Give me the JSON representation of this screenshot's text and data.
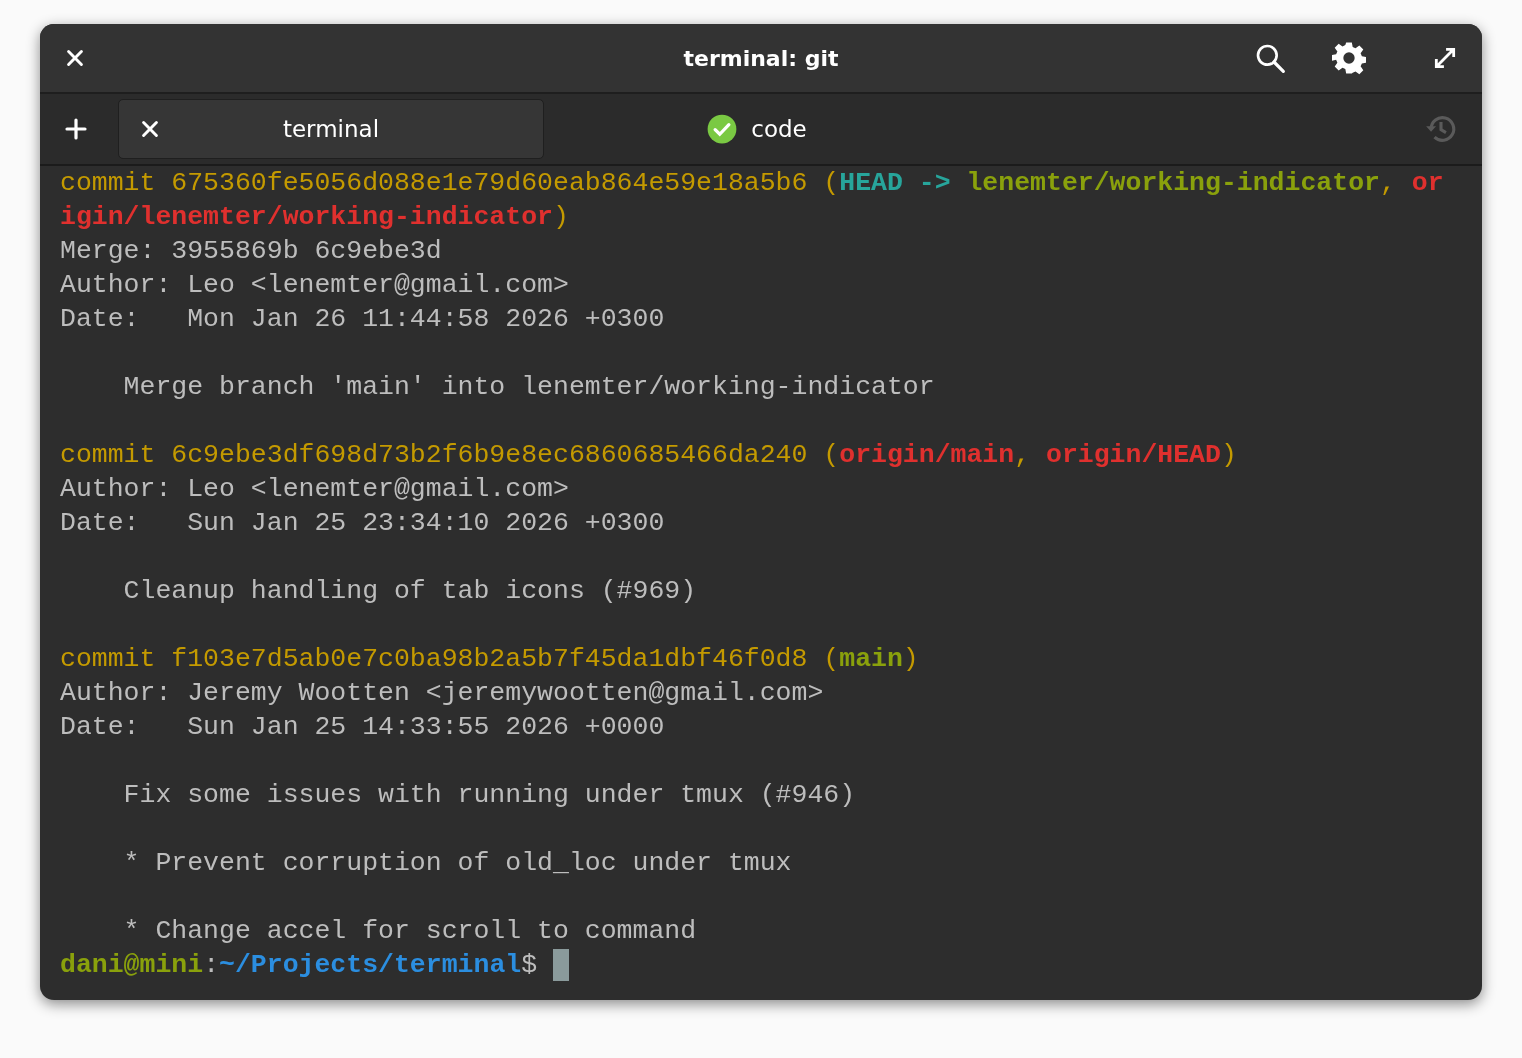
{
  "window": {
    "title": "terminal: git"
  },
  "tabs": [
    {
      "label": "terminal",
      "selected": true,
      "done": false
    },
    {
      "label": "code",
      "selected": false,
      "done": true
    }
  ],
  "paragraphs": [
    [
      {
        "segments": [
          {
            "text": "commit 675360fe5056d088e1e79d60eab864e59e18a5b6 (",
            "kind": "commit"
          },
          {
            "text": "HEAD -> ",
            "kind": "head"
          },
          {
            "text": "lenemter/working-indicator",
            "kind": "local"
          },
          {
            "text": ", ",
            "kind": "commit"
          },
          {
            "text": "or",
            "kind": "remote"
          }
        ]
      },
      {
        "segments": [
          {
            "text": "igin/lenemter/working-indicator",
            "kind": "remote"
          },
          {
            "text": ")",
            "kind": "commit"
          }
        ]
      },
      {
        "segments": [
          {
            "text": "Merge: 3955869b 6c9ebe3d",
            "kind": "plain"
          }
        ]
      },
      {
        "segments": [
          {
            "text": "Author: Leo <lenemter@gmail.com>",
            "kind": "plain"
          }
        ]
      },
      {
        "segments": [
          {
            "text": "Date:   Mon Jan 26 11:44:58 2026 +0300",
            "kind": "plain"
          }
        ]
      }
    ],
    [
      {
        "segments": [
          {
            "text": "    Merge branch 'main' into lenemter/working-indicator",
            "kind": "plain"
          }
        ]
      }
    ],
    [
      {
        "segments": [
          {
            "text": "commit 6c9ebe3df698d73b2f6b9e8ec6860685466da240 (",
            "kind": "commit"
          },
          {
            "text": "origin/main",
            "kind": "remote"
          },
          {
            "text": ", ",
            "kind": "commit"
          },
          {
            "text": "origin/HEAD",
            "kind": "remote"
          },
          {
            "text": ")",
            "kind": "commit"
          }
        ]
      },
      {
        "segments": [
          {
            "text": "Author: Leo <lenemter@gmail.com>",
            "kind": "plain"
          }
        ]
      },
      {
        "segments": [
          {
            "text": "Date:   Sun Jan 25 23:34:10 2026 +0300",
            "kind": "plain"
          }
        ]
      }
    ],
    [
      {
        "segments": [
          {
            "text": "    Cleanup handling of tab icons (#969)",
            "kind": "plain"
          }
        ]
      }
    ],
    [
      {
        "segments": [
          {
            "text": "commit f103e7d5ab0e7c0ba98b2a5b7f45da1dbf46f0d8 (",
            "kind": "commit"
          },
          {
            "text": "main",
            "kind": "local"
          },
          {
            "text": ")",
            "kind": "commit"
          }
        ]
      },
      {
        "segments": [
          {
            "text": "Author: Jeremy Wootten <jeremywootten@gmail.com>",
            "kind": "plain"
          }
        ]
      },
      {
        "segments": [
          {
            "text": "Date:   Sun Jan 25 14:33:55 2026 +0000",
            "kind": "plain"
          }
        ]
      }
    ],
    [
      {
        "segments": [
          {
            "text": "    Fix some issues with running under tmux (#946)",
            "kind": "plain"
          }
        ]
      }
    ],
    [
      {
        "segments": [
          {
            "text": "    * Prevent corruption of old_loc under tmux",
            "kind": "plain"
          }
        ]
      }
    ],
    [
      {
        "segments": [
          {
            "text": "    * Change accel for scroll to command",
            "kind": "plain"
          }
        ]
      },
      {
        "segments": [
          {
            "text": "dani@mini",
            "kind": "local"
          },
          {
            "text": ":",
            "kind": "plain"
          },
          {
            "text": "~/Projects/terminal",
            "kind": "path"
          },
          {
            "text": "$ ",
            "kind": "plain"
          }
        ],
        "cursor": true
      }
    ]
  ]
}
